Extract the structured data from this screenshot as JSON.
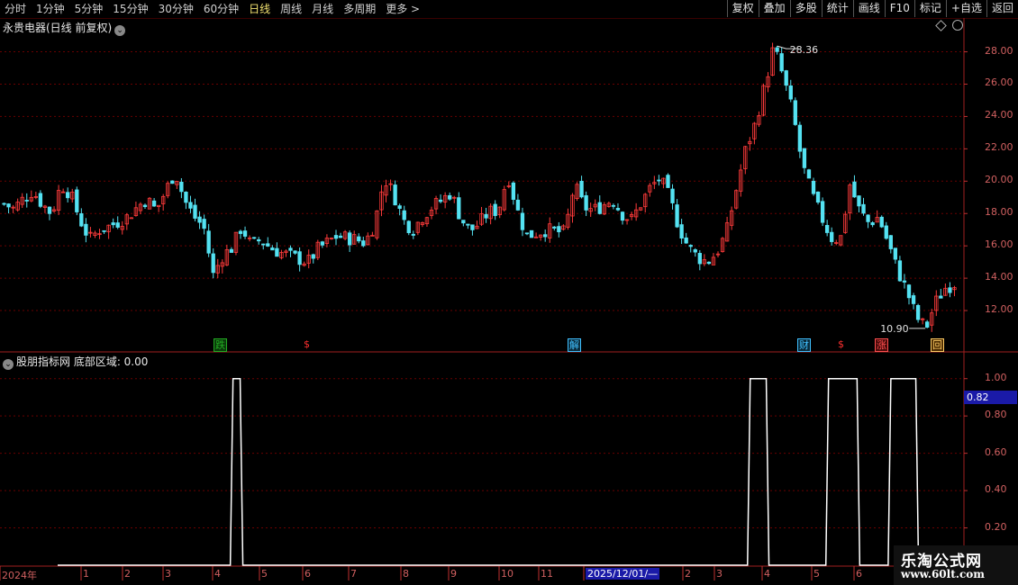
{
  "toolbar": {
    "periods": [
      "分时",
      "1分钟",
      "5分钟",
      "15分钟",
      "30分钟",
      "60分钟",
      "日线",
      "周线",
      "月线",
      "多周期",
      "更多 >"
    ],
    "active_period": "日线",
    "right_buttons": [
      "复权",
      "叠加",
      "多股",
      "统计",
      "画线",
      "F10",
      "标记",
      "+自选",
      "返回"
    ]
  },
  "main_panel": {
    "title": "永贵电器(日线 前复权)",
    "high_label": "28.36",
    "low_label": "10.90",
    "y_ticks": [
      "28.00",
      "26.00",
      "24.00",
      "22.00",
      "20.00",
      "18.00",
      "16.00",
      "14.00",
      "12.00"
    ],
    "events": [
      {
        "label": "跌",
        "color": "#22aa22",
        "bg": "#0a3a0a"
      },
      {
        "label": "$",
        "color": "#ff3030",
        "bg": "transparent"
      },
      {
        "label": "解",
        "color": "#40c0ff",
        "bg": "#0a2a3a"
      },
      {
        "label": "财",
        "color": "#40c0ff",
        "bg": "#0a2a3a"
      },
      {
        "label": "$",
        "color": "#ff3030",
        "bg": "transparent"
      },
      {
        "label": "涨",
        "color": "#ff5050",
        "bg": "#4a0a0a"
      },
      {
        "label": "回",
        "color": "#ffcc66",
        "bg": "#4a2a00"
      }
    ]
  },
  "indicator_panel": {
    "title": "股朋指标网 底部区域: 0.00",
    "current_value": "0.82",
    "y_ticks": [
      "1.00",
      "0.80",
      "0.60",
      "0.40",
      "0.20"
    ]
  },
  "x_axis": {
    "labels": [
      "2024年",
      "1",
      "2",
      "3",
      "4",
      "5",
      "6",
      "7",
      "8",
      "9",
      "10",
      "11",
      "2025/12/01/—",
      "2",
      "3",
      "4",
      "5",
      "6"
    ],
    "highlight": "2025/12/01/—"
  },
  "watermark": {
    "line1": "乐淘公式网",
    "line2": "www.60lt.com"
  },
  "colors": {
    "up": "#ff3b3b",
    "down": "#54e2f2",
    "grid": "#6a0000",
    "axis": "#c03030",
    "indicator": "#ffffff"
  },
  "chart_data": [
    {
      "type": "candlestick",
      "title": "永贵电器(日线 前复权)",
      "ylim": [
        10.5,
        29.2
      ],
      "annotations": [
        {
          "label": "28.36",
          "kind": "high"
        },
        {
          "label": "10.90",
          "kind": "low"
        }
      ],
      "close_trend": [
        18.6,
        18.3,
        18.9,
        19.4,
        18.6,
        18.0,
        19.8,
        19.2,
        17.6,
        16.4,
        17.0,
        17.2,
        17.5,
        17.8,
        18.4,
        18.9,
        18.2,
        19.4,
        20.6,
        18.8,
        17.8,
        17.2,
        14.2,
        15.4,
        15.9,
        17.2,
        16.0,
        16.4,
        15.9,
        15.6,
        15.4,
        15.2,
        15.0,
        15.8,
        16.2,
        16.6,
        16.5,
        16.4,
        16.2,
        17.4,
        20.2,
        19.2,
        17.6,
        17.0,
        17.8,
        18.4,
        18.8,
        19.3,
        17.8,
        16.9,
        17.4,
        18.1,
        18.2,
        20.4,
        18.2,
        16.6,
        16.8,
        17.0,
        16.9,
        16.8,
        19.8,
        18.4,
        18.2,
        18.5,
        18.9,
        18.0,
        17.6,
        18.6,
        19.6,
        20.2,
        19.0,
        17.2,
        15.9,
        15.3,
        15.0,
        15.6,
        16.8,
        19.4,
        21.9,
        23.5,
        25.8,
        28.36,
        26.4,
        24.2,
        21.0,
        19.2,
        17.8,
        16.5,
        16.4,
        19.8,
        18.2,
        17.4,
        17.8,
        16.2,
        14.5,
        13.2,
        11.6,
        10.9,
        12.5,
        13.4,
        13.7
      ]
    },
    {
      "type": "line",
      "title": "股朋指标网 底部区域",
      "ylim": [
        0,
        1.1
      ],
      "current": 0.82,
      "pulses": [
        {
          "x_from": 19.7,
          "x_to": 20.5,
          "value": 1.0
        },
        {
          "x_from": 77.8,
          "x_to": 79.6,
          "value": 1.0
        },
        {
          "x_from": 86.6,
          "x_to": 89.8,
          "value": 1.0
        },
        {
          "x_from": 93.6,
          "x_to": 96.4,
          "value": 1.0
        }
      ],
      "x_span": 101
    }
  ]
}
